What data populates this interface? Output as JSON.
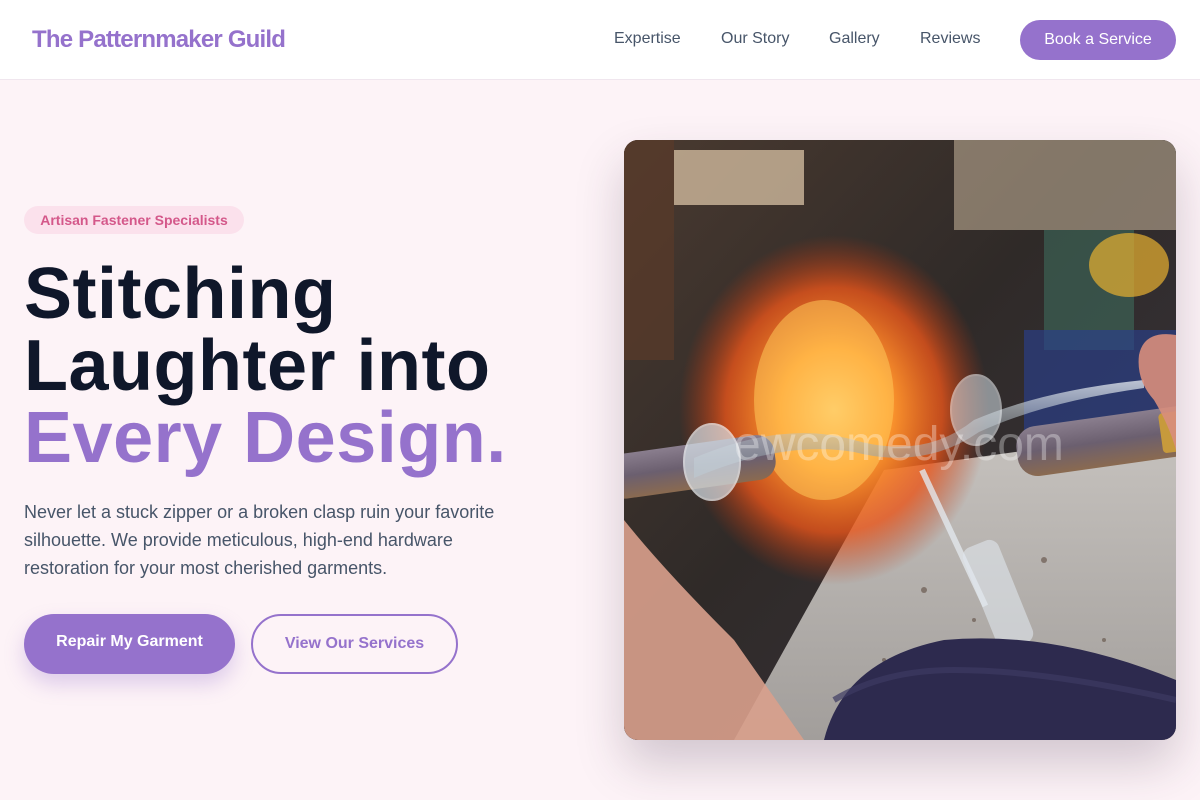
{
  "header": {
    "logo": "The Patternmaker Guild",
    "nav": [
      "Expertise",
      "Our Story",
      "Gallery",
      "Reviews"
    ],
    "cta_label": "Book a Service"
  },
  "hero": {
    "badge": "Artisan Fastener Specialists",
    "headline_line1": "Stitching",
    "headline_line2": "Laughter into",
    "headline_accent": "Every Design.",
    "subtext": "Never let a stuck zipper or a broken clasp ruin your favorite silhouette. We provide meticulous, high-end hardware restoration for your most cherished garments.",
    "primary_label": "Repair My Garment",
    "secondary_label": "View Our Services",
    "image_watermark": "ewcomedy.com"
  },
  "colors": {
    "accent": "#9572cc",
    "badge_text": "#d4588a",
    "badge_bg": "#fbe1ec",
    "page_bg": "#fdf3f7",
    "heading": "#0f172a",
    "body_text": "#475569"
  }
}
